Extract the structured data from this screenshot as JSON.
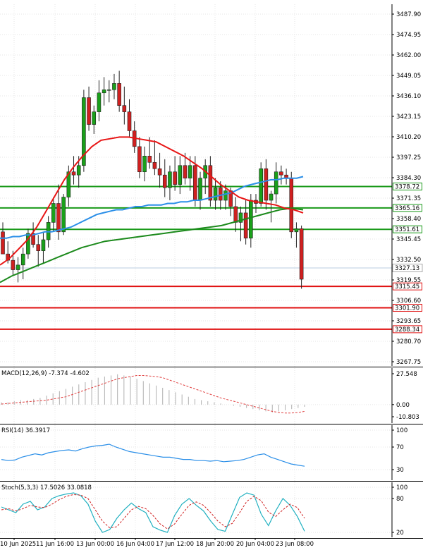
{
  "chart_data": [
    {
      "type": "candlestick",
      "panel": "price",
      "y_ticks": [
        "3487.90",
        "3474.95",
        "3462.00",
        "3449.05",
        "3436.10",
        "3423.15",
        "3410.20",
        "3397.25",
        "3384.30",
        "3371.35",
        "3358.40",
        "3345.45",
        "3332.50",
        "3319.55",
        "3306.60",
        "3293.65",
        "3280.70",
        "3267.75"
      ],
      "ylim": [
        3267.75,
        3487.9
      ],
      "current_price": "3327.13",
      "horizontal_levels": [
        {
          "value": "3378.72",
          "color": "#1a9a1a"
        },
        {
          "value": "3365.16",
          "color": "#1a9a1a"
        },
        {
          "value": "3351.61",
          "color": "#1a9a1a"
        },
        {
          "value": "3315.45",
          "color": "#e01010"
        },
        {
          "value": "3301.90",
          "color": "#e01010"
        },
        {
          "value": "3288.34",
          "color": "#e01010"
        }
      ],
      "candles": [
        [
          3350,
          3356,
          3340,
          3336
        ],
        [
          3336,
          3344,
          3330,
          3332
        ],
        [
          3332,
          3338,
          3322,
          3326
        ],
        [
          3326,
          3334,
          3318,
          3329
        ],
        [
          3329,
          3340,
          3320,
          3336
        ],
        [
          3336,
          3352,
          3333,
          3349
        ],
        [
          3349,
          3356,
          3340,
          3342
        ],
        [
          3342,
          3348,
          3328,
          3338
        ],
        [
          3338,
          3350,
          3330,
          3345
        ],
        [
          3345,
          3360,
          3340,
          3356
        ],
        [
          3356,
          3372,
          3350,
          3368
        ],
        [
          3368,
          3380,
          3345,
          3350
        ],
        [
          3350,
          3374,
          3348,
          3372
        ],
        [
          3372,
          3392,
          3366,
          3388
        ],
        [
          3388,
          3398,
          3380,
          3386
        ],
        [
          3386,
          3398,
          3378,
          3392
        ],
        [
          3392,
          3440,
          3388,
          3435
        ],
        [
          3435,
          3442,
          3414,
          3418
        ],
        [
          3418,
          3430,
          3412,
          3426
        ],
        [
          3426,
          3446,
          3420,
          3438
        ],
        [
          3438,
          3448,
          3430,
          3440
        ],
        [
          3440,
          3446,
          3432,
          3440
        ],
        [
          3440,
          3450,
          3434,
          3444
        ],
        [
          3444,
          3452,
          3426,
          3430
        ],
        [
          3430,
          3442,
          3418,
          3426
        ],
        [
          3426,
          3434,
          3410,
          3414
        ],
        [
          3414,
          3420,
          3400,
          3404
        ],
        [
          3404,
          3410,
          3384,
          3388
        ],
        [
          3388,
          3404,
          3382,
          3398
        ],
        [
          3398,
          3410,
          3390,
          3394
        ],
        [
          3394,
          3408,
          3386,
          3390
        ],
        [
          3390,
          3400,
          3378,
          3386
        ],
        [
          3386,
          3396,
          3372,
          3378
        ],
        [
          3378,
          3392,
          3370,
          3388
        ],
        [
          3388,
          3398,
          3376,
          3380
        ],
        [
          3380,
          3398,
          3374,
          3392
        ],
        [
          3392,
          3400,
          3380,
          3384
        ],
        [
          3384,
          3398,
          3376,
          3392
        ],
        [
          3392,
          3398,
          3366,
          3370
        ],
        [
          3370,
          3388,
          3364,
          3384
        ],
        [
          3384,
          3396,
          3374,
          3392
        ],
        [
          3392,
          3398,
          3366,
          3370
        ],
        [
          3370,
          3384,
          3364,
          3378
        ],
        [
          3378,
          3382,
          3364,
          3370
        ],
        [
          3370,
          3380,
          3364,
          3376
        ],
        [
          3376,
          3378,
          3360,
          3366
        ],
        [
          3366,
          3372,
          3350,
          3356
        ],
        [
          3356,
          3366,
          3344,
          3362
        ],
        [
          3362,
          3370,
          3342,
          3346
        ],
        [
          3346,
          3374,
          3340,
          3370
        ],
        [
          3370,
          3374,
          3362,
          3368
        ],
        [
          3368,
          3394,
          3366,
          3390
        ],
        [
          3390,
          3396,
          3364,
          3370
        ],
        [
          3370,
          3376,
          3356,
          3374
        ],
        [
          3374,
          3394,
          3368,
          3388
        ],
        [
          3388,
          3392,
          3380,
          3386
        ],
        [
          3386,
          3390,
          3380,
          3384
        ],
        [
          3384,
          3388,
          3346,
          3350
        ],
        [
          3350,
          3356,
          3340,
          3352
        ],
        [
          3352,
          3354,
          3314,
          3320
        ]
      ],
      "ma_blue": [
        3346,
        3346,
        3347,
        3347,
        3348,
        3348,
        3349,
        3350,
        3350,
        3351,
        3352,
        3353,
        3355,
        3357,
        3359,
        3361,
        3362,
        3363,
        3364,
        3364,
        3365,
        3366,
        3366,
        3367,
        3367,
        3367,
        3368,
        3368,
        3369,
        3369,
        3370,
        3370,
        3371,
        3372,
        3373,
        3374,
        3375,
        3377,
        3379,
        3380,
        3381,
        3382,
        3383,
        3383,
        3384,
        3384,
        3384,
        3385
      ],
      "ma_red": [
        3329,
        3333,
        3339,
        3345,
        3353,
        3363,
        3373,
        3383,
        3391,
        3398,
        3404,
        3408,
        3409,
        3410,
        3410,
        3409,
        3408,
        3407,
        3404,
        3401,
        3398,
        3394,
        3390,
        3385,
        3380,
        3376,
        3372,
        3370,
        3369,
        3368,
        3367,
        3365,
        3364,
        3362
      ],
      "ma_green": [
        3318,
        3322,
        3325,
        3328,
        3331,
        3334,
        3337,
        3340,
        3342,
        3344,
        3345,
        3346,
        3347,
        3348,
        3349,
        3350,
        3351,
        3352,
        3353,
        3354,
        3356,
        3358,
        3360,
        3362,
        3364,
        3365,
        3364
      ]
    },
    {
      "type": "histogram",
      "panel": "macd",
      "label": "MACD(12,26,9) -7.374 -4.602",
      "y_ticks": [
        "27.548",
        "0.00",
        "-10.803"
      ],
      "ylim": [
        -10.803,
        27.548
      ],
      "histogram": [
        2,
        2,
        3,
        4,
        4,
        5,
        6,
        8,
        10,
        12,
        14,
        16,
        18,
        20,
        22,
        24,
        25,
        26,
        27,
        26,
        25,
        23,
        21,
        19,
        17,
        15,
        13,
        11,
        9,
        7,
        5,
        4,
        3,
        2,
        1,
        0,
        -1,
        -2,
        -3,
        -4,
        -5,
        -6,
        -7,
        -6,
        -5,
        -4,
        -3,
        -2
      ],
      "signal": [
        0.5,
        1,
        1.5,
        2,
        2.5,
        3,
        3.5,
        4,
        5,
        6,
        7,
        9,
        11,
        13,
        15,
        17,
        19,
        21,
        23,
        24,
        25,
        26,
        26,
        25.5,
        25,
        24,
        22,
        20,
        18,
        16,
        14,
        12,
        10,
        8,
        6,
        4.5,
        3,
        1.5,
        0,
        -1.5,
        -3,
        -4.5,
        -6,
        -7,
        -7.5,
        -7.5,
        -7,
        -6
      ]
    },
    {
      "type": "line",
      "panel": "rsi",
      "label": "RSI(14) 36.3917",
      "y_ticks": [
        "100",
        "70",
        "30",
        "0"
      ],
      "ylim": [
        0,
        100
      ],
      "values": [
        48,
        46,
        47,
        52,
        55,
        58,
        56,
        60,
        62,
        64,
        65,
        63,
        67,
        70,
        72,
        73,
        75,
        70,
        66,
        62,
        60,
        58,
        56,
        54,
        52,
        52,
        50,
        48,
        48,
        46,
        46,
        45,
        46,
        44,
        45,
        46,
        48,
        52,
        56,
        58,
        52,
        48,
        44,
        40,
        38,
        36
      ]
    },
    {
      "type": "line",
      "panel": "stochastic",
      "label": "Stoch(5,3,3) 17.5026 33.0818",
      "y_ticks": [
        "100",
        "80",
        "20",
        "0"
      ],
      "ylim": [
        0,
        100
      ],
      "main": [
        65,
        60,
        55,
        70,
        75,
        60,
        65,
        80,
        85,
        88,
        90,
        85,
        70,
        40,
        20,
        25,
        45,
        60,
        72,
        62,
        55,
        30,
        24,
        20,
        50,
        70,
        80,
        68,
        58,
        40,
        25,
        22,
        52,
        82,
        90,
        86,
        52,
        32,
        58,
        80,
        68,
        48,
        22
      ],
      "signal": [
        60,
        62,
        58,
        62,
        68,
        65,
        64,
        70,
        78,
        84,
        87,
        86,
        80,
        60,
        40,
        28,
        30,
        45,
        60,
        66,
        62,
        50,
        35,
        26,
        35,
        52,
        68,
        74,
        68,
        55,
        40,
        30,
        36,
        55,
        75,
        84,
        76,
        56,
        48,
        60,
        70,
        64,
        45
      ]
    }
  ],
  "x_axis_labels": [
    "10 Jun 2025",
    "11 Jun 16:00",
    "13 Jun 00:00",
    "16 Jun 04:00",
    "17 Jun 12:00",
    "18 Jun 20:00",
    "20 Jun 04:00",
    "23 Jun 08:00"
  ],
  "colors": {
    "bull": "#1aa01a",
    "bear": "#d02020",
    "ma_blue": "#2b8fe8",
    "ma_red": "#e81515",
    "ma_green": "#1c8a1c",
    "grid": "#e6e6e6",
    "axis": "#000000",
    "price_label_bg": "#ffffff",
    "macd_hist": "#b0b0b0",
    "macd_signal": "#e04040",
    "rsi": "#2b8fe8",
    "stoch_main": "#20b0c0",
    "stoch_signal": "#d02020"
  }
}
